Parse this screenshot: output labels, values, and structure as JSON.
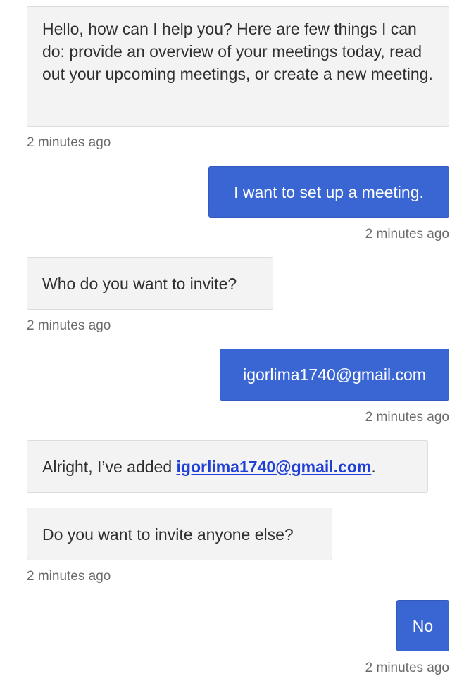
{
  "messages": {
    "m1": {
      "sender": "bot",
      "text": "Hello, how can I help you? Here are few things I can do: provide an overview of your meetings today, read out your upcoming meetings, or create a new meeting.",
      "time": "2 minutes ago"
    },
    "m2": {
      "sender": "user",
      "text": "I want to set up a meeting.",
      "time": "2 minutes ago"
    },
    "m3": {
      "sender": "bot",
      "text": "Who do you want to invite?",
      "time": "2 minutes ago"
    },
    "m4": {
      "sender": "user",
      "text": "igorlima1740@gmail.com",
      "time": "2 minutes ago"
    },
    "m5": {
      "sender": "bot",
      "prefix": "Alright, I’ve added ",
      "link": "igorlima1740@gmail.com",
      "suffix": "."
    },
    "m6": {
      "sender": "bot",
      "text": "Do you want to invite anyone else?",
      "time": "2 minutes ago"
    },
    "m7": {
      "sender": "user",
      "text": "No",
      "time": "2 minutes ago"
    }
  },
  "colors": {
    "bot_bubble": "#f3f3f3",
    "user_bubble": "#3a66d3",
    "link": "#1f3fd6"
  }
}
